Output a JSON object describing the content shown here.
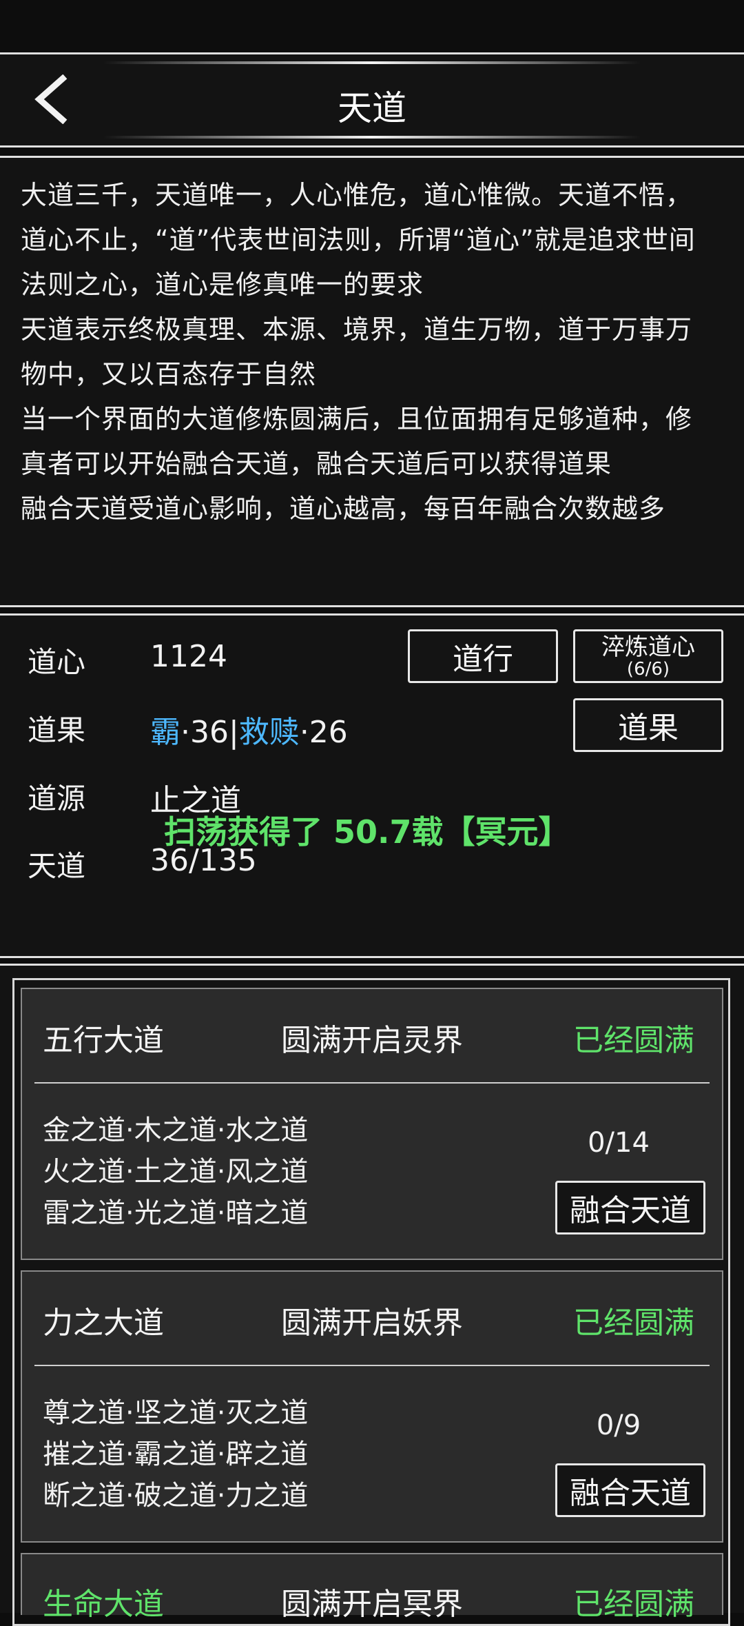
{
  "header": {
    "title": "天道"
  },
  "description": [
    "大道三千，天道唯一，人心惟危，道心惟微。天道不悟，",
    "道心不止，“道”代表世间法则，所谓“道心”就是追求世间",
    "法则之心，道心是修真唯一的要求",
    "天道表示终极真理、本源、境界，道生万物，道于万事万",
    "物中，又以百态存于自然",
    "当一个界面的大道修炼圆满后，且位面拥有足够道种，修",
    "真者可以开始融合天道，融合天道后可以获得道果",
    "融合天道受道心影响，道心越高，每百年融合次数越多"
  ],
  "stats": {
    "daoxin_label": "道心",
    "daoxin_value": "1124",
    "daoguo_label": "道果",
    "daoguo_a_name": "霸",
    "daoguo_a_value": "·36",
    "daoguo_sep": "|",
    "daoguo_b_name": "救赎",
    "daoguo_b_value": "·26",
    "daoyuan_label": "道源",
    "daoyuan_value": "止之道",
    "tiandao_label": "天道",
    "tiandao_value": "36/135",
    "daoxing_button": "道行",
    "cuilian_button": "淬炼道心",
    "cuilian_count": "(6/6)",
    "daoguo_button": "道果",
    "toast": "扫荡获得了 50.7载【冥元】",
    "colors": {
      "accent_green": "#5fe36a",
      "accent_blue": "#4db8ff"
    }
  },
  "daos": [
    {
      "name": "五行大道",
      "open": "圆满开启灵界",
      "status": "已经圆满",
      "lines": [
        "金之道·木之道·水之道",
        "火之道·土之道·风之道",
        "雷之道·光之道·暗之道"
      ],
      "progress": "0/14",
      "fuse_button": "融合天道"
    },
    {
      "name": "力之大道",
      "open": "圆满开启妖界",
      "status": "已经圆满",
      "lines": [
        "尊之道·坚之道·灭之道",
        "摧之道·霸之道·辟之道",
        "断之道·破之道·力之道"
      ],
      "progress": "0/9",
      "fuse_button": "融合天道"
    },
    {
      "name": "生命大道",
      "open": "圆满开启冥界",
      "status": "已经圆满"
    }
  ]
}
